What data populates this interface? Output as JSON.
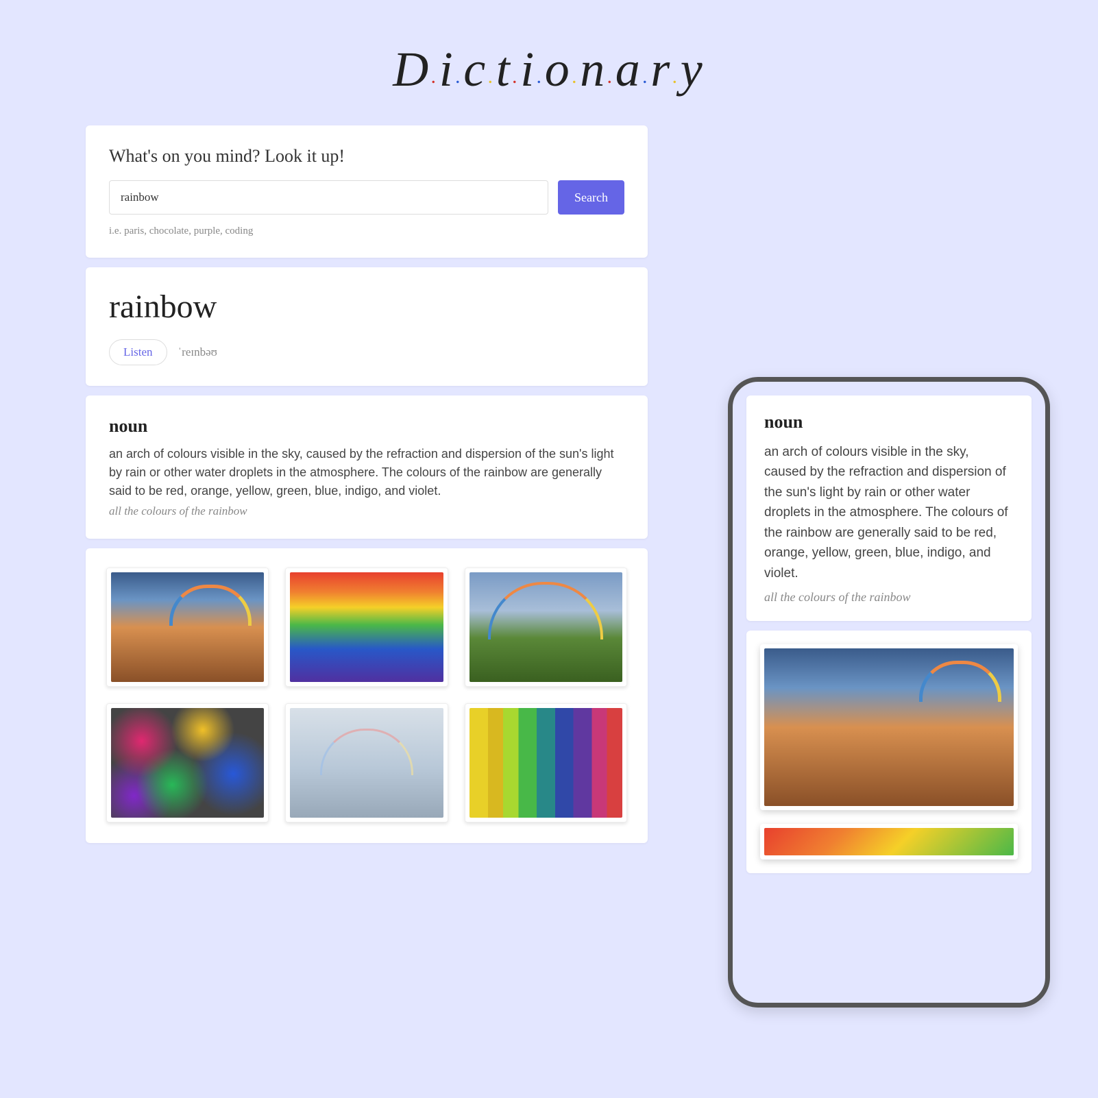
{
  "logo": {
    "text": "Dictionary"
  },
  "search": {
    "title": "What's on you mind? Look it up!",
    "value": "rainbow",
    "button": "Search",
    "hint": "i.e. paris, chocolate, purple, coding"
  },
  "result": {
    "word": "rainbow",
    "listen": "Listen",
    "pronunciation": "ˈreɪnbəʊ"
  },
  "entry": {
    "pos": "noun",
    "definition": "an arch of colours visible in the sky, caused by the refraction and dispersion of the sun's light by rain or other water droplets in the atmosphere. The colours of the rainbow are generally said to be red, orange, yellow, green, blue, indigo, and violet.",
    "example": "all the colours of the rainbow"
  },
  "gallery": {
    "items": [
      {
        "name": "rainbow-boardwalk"
      },
      {
        "name": "rainbow-paint-stripes"
      },
      {
        "name": "double-rainbow-field"
      },
      {
        "name": "rainbow-glitter"
      },
      {
        "name": "faint-rainbow-sky"
      },
      {
        "name": "color-swatches"
      }
    ]
  },
  "mobile": {
    "entry": {
      "pos": "noun",
      "definition": "an arch of colours visible in the sky, caused by the refraction and dispersion of the sun's light by rain or other water droplets in the atmosphere. The colours of the rainbow are generally said to be red, orange, yellow, green, blue, indigo, and violet.",
      "example": "all the colours of the rainbow"
    },
    "gallery": {
      "items": [
        {
          "name": "rainbow-boardwalk"
        },
        {
          "name": "rainbow-paint-stripes"
        }
      ]
    }
  }
}
